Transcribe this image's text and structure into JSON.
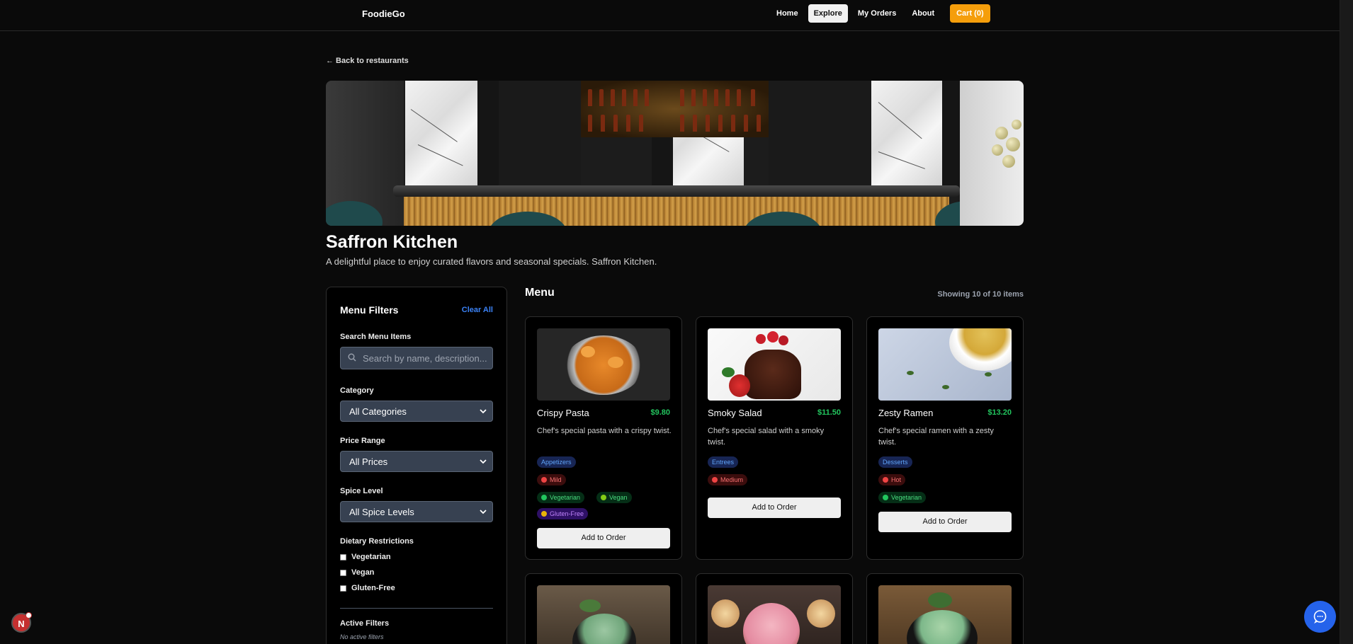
{
  "brand": "FoodieGo",
  "nav": {
    "items": [
      {
        "label": "Home"
      },
      {
        "label": "Explore"
      },
      {
        "label": "My Orders"
      },
      {
        "label": "About"
      }
    ],
    "cart_label": "Cart (0)"
  },
  "back_link": "← Back to restaurants",
  "restaurant": {
    "name": "Saffron Kitchen",
    "description": "A delightful place to enjoy curated flavors and seasonal specials. Saffron Kitchen."
  },
  "filters": {
    "title": "Menu Filters",
    "clear_label": "Clear All",
    "search_label": "Search Menu Items",
    "search_placeholder": "Search by name, description...",
    "category_label": "Category",
    "category_value": "All Categories",
    "price_label": "Price Range",
    "price_value": "All Prices",
    "spice_label": "Spice Level",
    "spice_value": "All Spice Levels",
    "dietary_label": "Dietary Restrictions",
    "dietary_options": [
      "Vegetarian",
      "Vegan",
      "Gluten-Free"
    ],
    "active_label": "Active Filters",
    "active_none": "No active filters"
  },
  "menu": {
    "heading": "Menu",
    "showing": "Showing 10 of 10 items",
    "add_label": "Add to Order",
    "items": [
      {
        "name": "Crispy Pasta",
        "price": "$9.80",
        "description": "Chef's special pasta with a crispy twist.",
        "category": "Appetizers",
        "spice": "Mild",
        "tags": [
          "Vegetarian",
          "Vegan"
        ],
        "tags2": [
          "Gluten-Free"
        ]
      },
      {
        "name": "Smoky Salad",
        "price": "$11.50",
        "description": "Chef's special salad with a smoky twist.",
        "category": "Entrees",
        "spice": "Medium"
      },
      {
        "name": "Zesty Ramen",
        "price": "$13.20",
        "description": "Chef's special ramen with a zesty twist.",
        "category": "Desserts",
        "spice": "Hot",
        "tags": [
          "Vegetarian"
        ]
      }
    ]
  },
  "badge_letter": "N"
}
